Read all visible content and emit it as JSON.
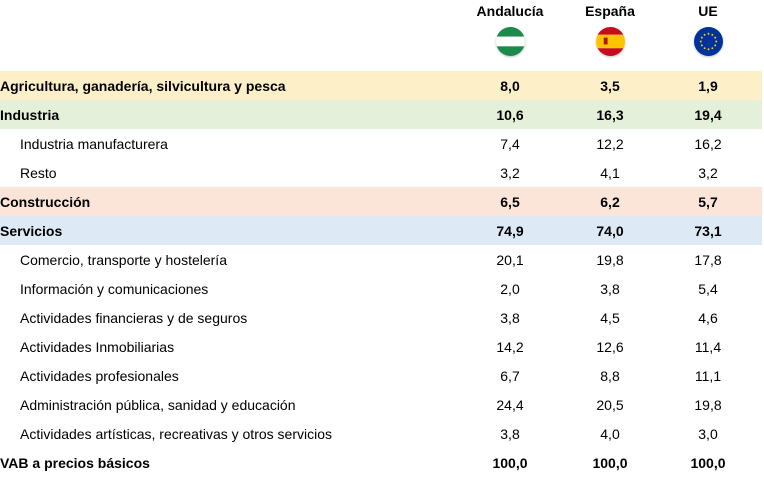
{
  "columns": {
    "andalucia": "Andalucía",
    "espana": "España",
    "ue": "UE"
  },
  "flags": {
    "andalucia_colors": [
      "#1b8a4a",
      "#ffffff",
      "#1b8a4a"
    ],
    "espana_colors": [
      "#c60b1e",
      "#ffc400",
      "#c60b1e"
    ],
    "ue_colors": [
      "#003399",
      "#ffcc00"
    ]
  },
  "rows": [
    {
      "label": "Agricultura, ganadería, silvicultura y pesca",
      "andalucia": "8,0",
      "espana": "3,5",
      "ue": "1,9"
    },
    {
      "label": "Industria",
      "andalucia": "10,6",
      "espana": "16,3",
      "ue": "19,4"
    },
    {
      "label": "Industria manufacturera",
      "andalucia": "7,4",
      "espana": "12,2",
      "ue": "16,2"
    },
    {
      "label": "Resto",
      "andalucia": "3,2",
      "espana": "4,1",
      "ue": "3,2"
    },
    {
      "label": "Construcción",
      "andalucia": "6,5",
      "espana": "6,2",
      "ue": "5,7"
    },
    {
      "label": "Servicios",
      "andalucia": "74,9",
      "espana": "74,0",
      "ue": "73,1"
    },
    {
      "label": "Comercio, transporte y hostelería",
      "andalucia": "20,1",
      "espana": "19,8",
      "ue": "17,8"
    },
    {
      "label": "Información y comunicaciones",
      "andalucia": "2,0",
      "espana": "3,8",
      "ue": "5,4"
    },
    {
      "label": "Actividades financieras y de seguros",
      "andalucia": "3,8",
      "espana": "4,5",
      "ue": "4,6"
    },
    {
      "label": "Actividades Inmobiliarias",
      "andalucia": "14,2",
      "espana": "12,6",
      "ue": "11,4"
    },
    {
      "label": "Actividades profesionales",
      "andalucia": "6,7",
      "espana": "8,8",
      "ue": "11,1"
    },
    {
      "label": "Administración pública, sanidad y educación",
      "andalucia": "24,4",
      "espana": "20,5",
      "ue": "19,8"
    },
    {
      "label": "Actividades artísticas, recreativas y otros servicios",
      "andalucia": "3,8",
      "espana": "4,0",
      "ue": "3,0"
    },
    {
      "label": "VAB a precios básicos",
      "andalucia": "100,0",
      "espana": "100,0",
      "ue": "100,0"
    }
  ]
}
